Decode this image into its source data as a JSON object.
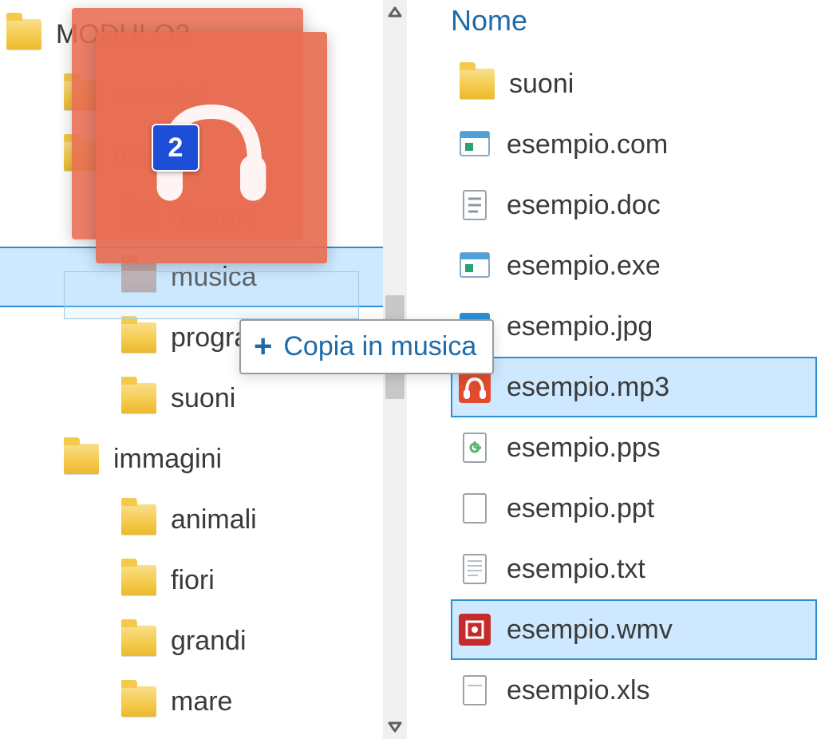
{
  "tree": {
    "root": "MODULO2",
    "items": [
      {
        "label": "esercizi",
        "indent": 1,
        "muted": false
      },
      {
        "label": "files",
        "indent": 1,
        "muted": false
      },
      {
        "label": "disegni",
        "indent": 2,
        "muted": true
      },
      {
        "label": "musica",
        "indent": 2,
        "muted": true,
        "dropTarget": true
      },
      {
        "label": "programmi",
        "indent": 2,
        "muted": false
      },
      {
        "label": "suoni",
        "indent": 2,
        "muted": false
      },
      {
        "label": "immagini",
        "indent": 1,
        "muted": false
      },
      {
        "label": "animali",
        "indent": 2,
        "muted": false
      },
      {
        "label": "fiori",
        "indent": 2,
        "muted": false
      },
      {
        "label": "grandi",
        "indent": 2,
        "muted": false
      },
      {
        "label": "mare",
        "indent": 2,
        "muted": false
      }
    ]
  },
  "list": {
    "header": "Nome",
    "items": [
      {
        "label": "suoni",
        "type": "folder",
        "selected": false
      },
      {
        "label": "esempio.com",
        "type": "com",
        "selected": false
      },
      {
        "label": "esempio.doc",
        "type": "doc",
        "selected": false
      },
      {
        "label": "esempio.exe",
        "type": "exe",
        "selected": false
      },
      {
        "label": "esempio.jpg",
        "type": "jpg",
        "selected": false
      },
      {
        "label": "esempio.mp3",
        "type": "mp3",
        "selected": true
      },
      {
        "label": "esempio.pps",
        "type": "pps",
        "selected": false
      },
      {
        "label": "esempio.ppt",
        "type": "ppt",
        "selected": false
      },
      {
        "label": "esempio.txt",
        "type": "txt",
        "selected": false
      },
      {
        "label": "esempio.wmv",
        "type": "wmv",
        "selected": true
      },
      {
        "label": "esempio.xls",
        "type": "xls",
        "selected": false
      }
    ]
  },
  "drag": {
    "count": "2",
    "tooltip_label": "Copia in musica"
  }
}
